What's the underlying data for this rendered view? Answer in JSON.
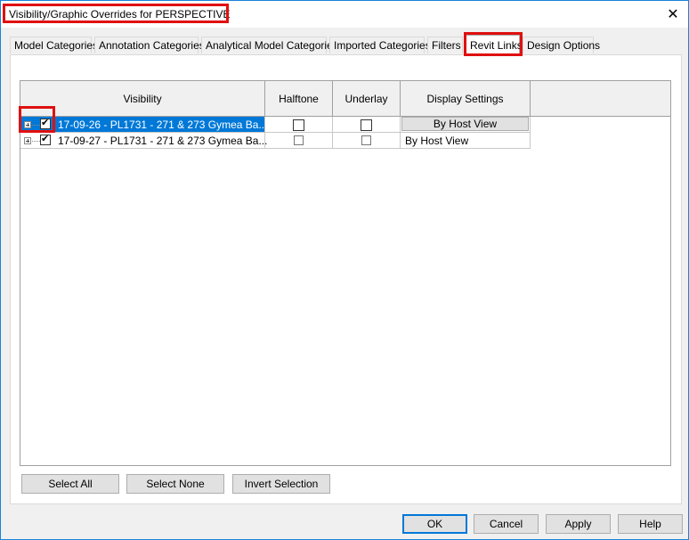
{
  "window": {
    "title": "Visibility/Graphic Overrides for PERSPECTIVE",
    "close_glyph": "✕"
  },
  "tabs": [
    {
      "label": "Model Categories"
    },
    {
      "label": "Annotation Categories"
    },
    {
      "label": "Analytical Model Categories"
    },
    {
      "label": "Imported Categories"
    },
    {
      "label": "Filters"
    },
    {
      "label": "Revit Links"
    },
    {
      "label": "Design Options"
    }
  ],
  "active_tab": "Revit Links",
  "grid": {
    "columns": [
      "Visibility",
      "Halftone",
      "Underlay",
      "Display Settings"
    ],
    "rows": [
      {
        "name": "17-09-26 - PL1731 - 271 & 273 Gymea Ba...",
        "visible": true,
        "halftone": false,
        "underlay": false,
        "display": "By Host View",
        "selected": true
      },
      {
        "name": "17-09-27 - PL1731 - 271 & 273 Gymea Ba...",
        "visible": true,
        "halftone": false,
        "underlay": false,
        "display": "By Host View",
        "selected": false
      }
    ]
  },
  "buttons": {
    "select_all": "Select All",
    "select_none": "Select None",
    "invert_selection": "Invert Selection",
    "ok": "OK",
    "cancel": "Cancel",
    "apply": "Apply",
    "help": "Help"
  },
  "colors": {
    "annotation_red": "#e01010",
    "selection_blue": "#0078d7"
  }
}
